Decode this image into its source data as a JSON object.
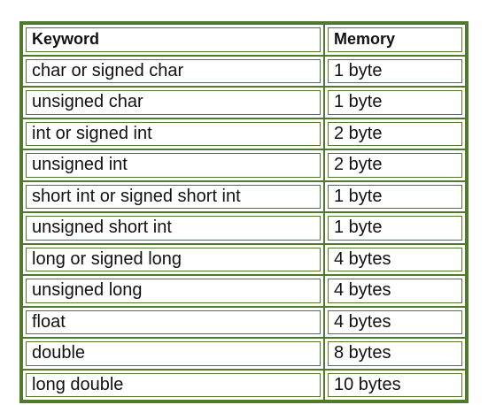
{
  "table": {
    "headers": [
      "Keyword",
      "Memory"
    ],
    "rows": [
      [
        "char or signed char",
        "1 byte"
      ],
      [
        "unsigned char",
        "1 byte"
      ],
      [
        "int or signed int",
        "2 byte"
      ],
      [
        "unsigned int",
        "2 byte"
      ],
      [
        "short int or signed short int",
        "1 byte"
      ],
      [
        "unsigned short int",
        "1 byte"
      ],
      [
        "long or signed long",
        "4 bytes"
      ],
      [
        "unsigned long",
        "4 bytes"
      ],
      [
        "float",
        "4 bytes"
      ],
      [
        "double",
        "8 bytes"
      ],
      [
        "long double",
        "10 bytes"
      ]
    ],
    "border_color": "#4f7a2b"
  }
}
